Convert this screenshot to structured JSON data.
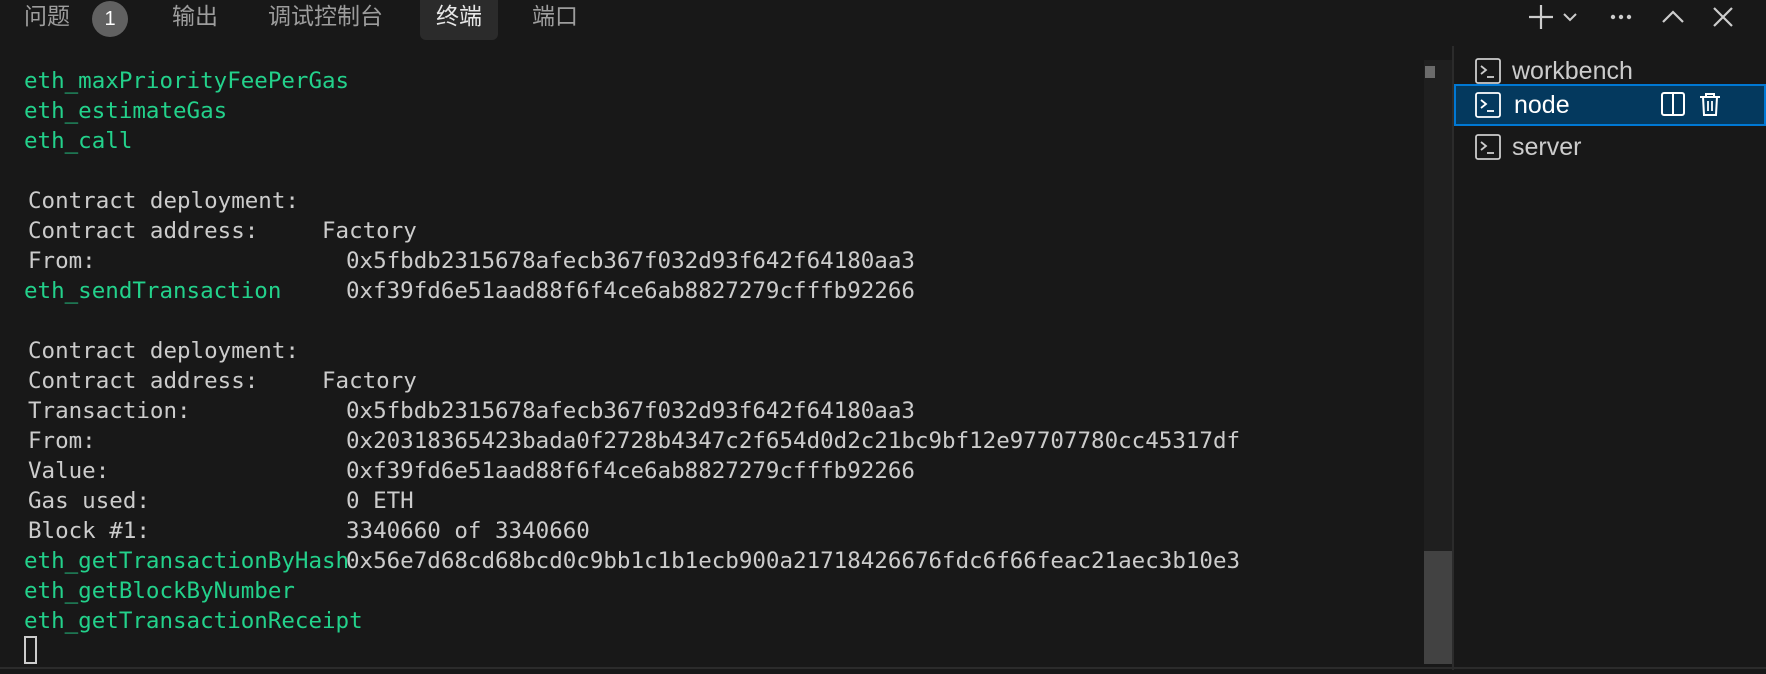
{
  "tabs": {
    "problems": "问题",
    "problems_count": "1",
    "output": "输出",
    "debug_console": "调试控制台",
    "terminal": "终端",
    "ports": "端口"
  },
  "actions": [
    {
      "name": "add-terminal-icon"
    },
    {
      "name": "chevron-down-icon"
    },
    {
      "name": "more-icon"
    },
    {
      "name": "maximize-panel-icon"
    },
    {
      "name": "close-icon"
    }
  ],
  "terminal_output": {
    "m1": "eth_maxPriorityFeePerGas",
    "m2": "eth_estimateGas",
    "m3": "eth_call",
    "call": {
      "deploy_label": "Contract deployment:",
      "deploy_value": "Factory",
      "address_label": "Contract address:",
      "address_value": "0x5fbdb2315678afecb367f032d93f642f64180aa3",
      "from_label": "From:",
      "from_value": "0xf39fd6e51aad88f6f4ce6ab8827279cfffb92266"
    },
    "m4": "eth_sendTransaction",
    "send": {
      "deploy_label": "Contract deployment:",
      "deploy_value": "Factory",
      "address_label": "Contract address:",
      "address_value": "0x5fbdb2315678afecb367f032d93f642f64180aa3",
      "tx_label": "Transaction:",
      "tx_value": "0x20318365423bada0f2728b4347c2f654d0d2c21bc9bf12e97707780cc45317df",
      "from_label": "From:",
      "from_value": "0xf39fd6e51aad88f6f4ce6ab8827279cfffb92266",
      "value_label": "Value:",
      "value_value": "0 ETH",
      "gas_label": "Gas used:",
      "gas_value": "3340660 of 3340660",
      "block_label": "Block #1:",
      "block_value": "0x56e7d68cd68bcd0c9bb1c1b1ecb900a21718426676fdc6f66feac21aec3b10e3"
    },
    "m5": "eth_getTransactionByHash",
    "m6": "eth_getBlockByNumber",
    "m7": "eth_getTransactionReceipt"
  },
  "terminals": [
    {
      "name": "workbench",
      "selected": false
    },
    {
      "name": "node",
      "selected": true
    },
    {
      "name": "server",
      "selected": false
    }
  ],
  "colors": {
    "method": "#23d18b",
    "text": "#cccccc",
    "background": "#181818",
    "selection": "#04395e",
    "focus_border": "#0078d4"
  }
}
